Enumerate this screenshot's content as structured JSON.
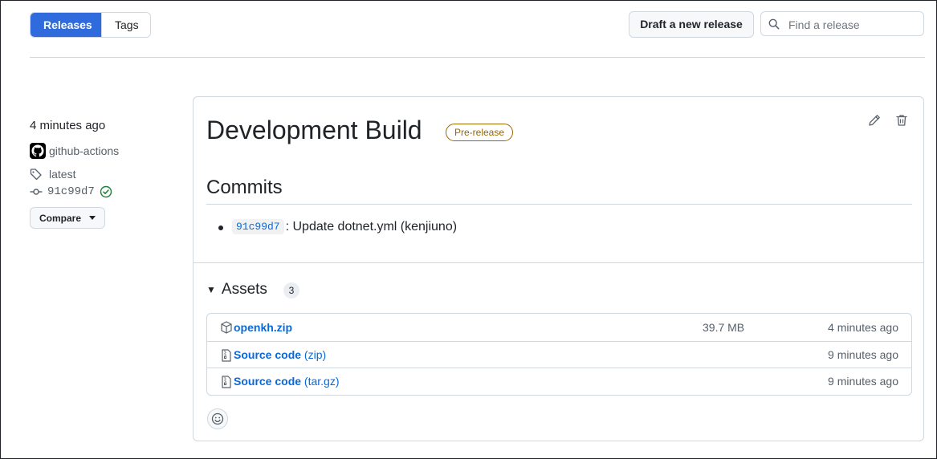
{
  "toolbar": {
    "tabs": [
      {
        "label": "Releases",
        "active": true
      },
      {
        "label": "Tags",
        "active": false
      }
    ],
    "draft_button": "Draft a new release",
    "search_placeholder": "Find a release"
  },
  "release_meta": {
    "time": "4 minutes ago",
    "author": "github-actions",
    "tag": "latest",
    "commit": "91c99d7",
    "compare_label": "Compare"
  },
  "release": {
    "title": "Development Build",
    "badge": "Pre-release",
    "commits_heading": "Commits",
    "commits": [
      {
        "sha": "91c99d7",
        "message": ": Update dotnet.yml (kenjiuno)"
      }
    ],
    "assets_heading": "Assets",
    "assets_count": "3",
    "assets": [
      {
        "icon": "package-icon",
        "name": "openkh.zip",
        "ext": "",
        "size": "39.7 MB",
        "time": "4 minutes ago"
      },
      {
        "icon": "file-zip-icon",
        "name": "Source code",
        "ext": " (zip)",
        "size": "",
        "time": "9 minutes ago"
      },
      {
        "icon": "file-zip-icon",
        "name": "Source code",
        "ext": " (tar.gz)",
        "size": "",
        "time": "9 minutes ago"
      }
    ]
  },
  "colors": {
    "accent": "#2f6bdc",
    "link": "#0969da",
    "prerelease": "#9a6700",
    "success": "#1a7f37"
  }
}
